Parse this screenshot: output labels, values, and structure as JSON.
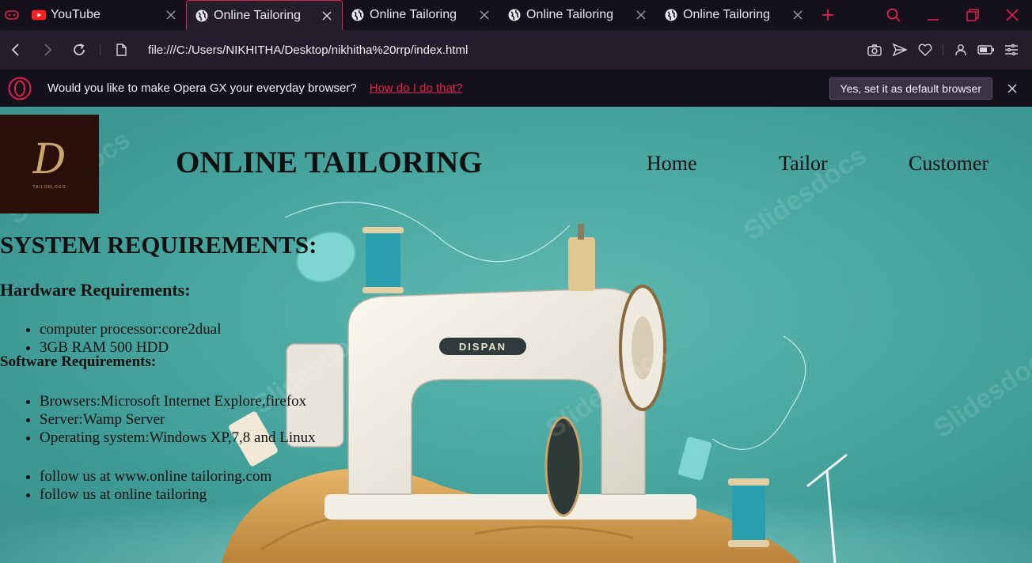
{
  "browser": {
    "tabs": [
      {
        "title": "YouTube",
        "icon": "youtube-icon"
      },
      {
        "title": "Online Tailoring",
        "icon": "globe-icon",
        "active": true
      },
      {
        "title": "Online Tailoring",
        "icon": "globe-icon"
      },
      {
        "title": "Online Tailoring",
        "icon": "globe-icon"
      },
      {
        "title": "Online Tailoring",
        "icon": "globe-icon"
      }
    ],
    "url": "file:///C:/Users/NIKHITHA/Desktop/nikhitha%20rrp/index.html",
    "accent": "#e0224a"
  },
  "notification": {
    "message": "Would you like to make Opera GX your everyday browser?",
    "link": "How do I do that?",
    "button": "Yes, set it as default browser"
  },
  "page": {
    "logo_letter": "D",
    "logo_text": "TAILORLOGO",
    "title": "ONLINE TAILORING",
    "menu": [
      "Home",
      "Tailor",
      "Customer"
    ],
    "heading": "SYSTEM REQUIREMENTS:",
    "hardware_heading": "Hardware Requirements:",
    "hardware": [
      "computer processor:core2dual",
      "3GB RAM 500 HDD"
    ],
    "software_heading": "Software Requirements:",
    "software": [
      "Browsers:Microsoft Internet Explore,firefox",
      "Server:Wamp Server",
      "Operating system:Windows XP,7,8 and Linux"
    ],
    "follow": [
      "follow us at www.online tailoring.com",
      "follow us at online tailoring"
    ]
  }
}
